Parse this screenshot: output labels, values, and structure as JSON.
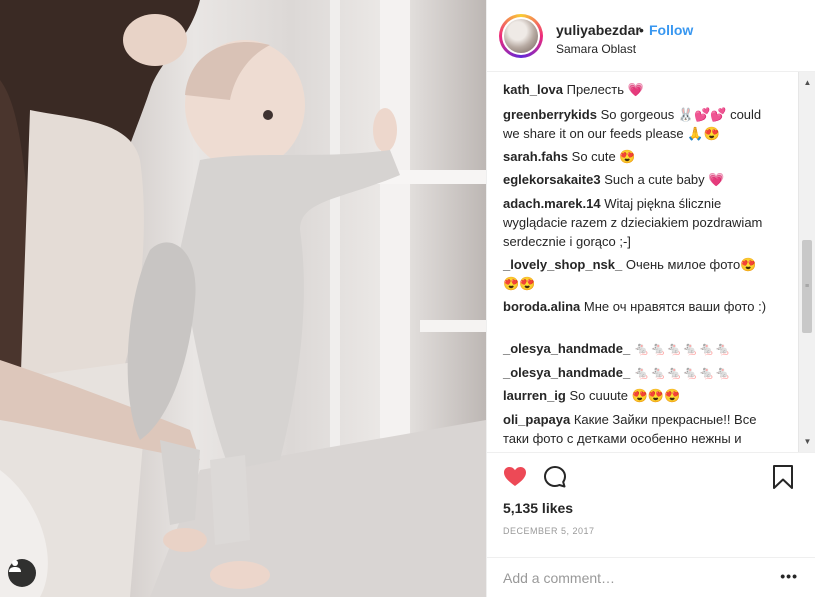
{
  "post": {
    "username": "yuliyabezdar",
    "separator": "•",
    "follow_label": "Follow",
    "location": "Samara Oblast"
  },
  "comments": [
    {
      "user": "kath_lova",
      "text": "Прелесть 💗"
    },
    {
      "user": "greenberrykids",
      "text": "So gorgeous 🐰💕💕 could we share it on our feeds please 🙏😍"
    },
    {
      "user": "sarah.fahs",
      "text": "So cute 😍"
    },
    {
      "user": "eglekorsakaite3",
      "text": "Such a cute baby 💗"
    },
    {
      "user": "adach.marek.14",
      "text": "Witaj piękna ślicznie wyglądacie razem z dzieciakiem pozdrawiam serdecznie i gorąco ;-]"
    },
    {
      "user": "_lovely_shop_nsk_",
      "text": "Очень милое фото😍😍😍"
    },
    {
      "user": "boroda.alina",
      "text": "Мне оч нравятся ваши фото :)"
    },
    {
      "user": "_olesya_handmade_",
      "text": "🐁🐁🐁🐁🐁🐁"
    },
    {
      "user": "_olesya_handmade_",
      "text": "🐁🐁🐁🐁🐁🐁"
    },
    {
      "user": "laurren_ig",
      "text": "So cuuute 😍😍😍"
    },
    {
      "user": "oli_papaya",
      "text": "Какие Зайки прекрасные!! Все таки фото с детками особенно нежны и"
    }
  ],
  "actions": {
    "like_icon": "heart-filled-icon",
    "comment_icon": "comment-bubble-icon",
    "save_icon": "bookmark-icon",
    "likes_text": "5,135 likes",
    "date_text": "DECEMBER 5, 2017"
  },
  "add_comment": {
    "placeholder": "Add a comment…",
    "more_label": "•••"
  },
  "colors": {
    "accent": "#3897f0",
    "like": "#ed4956",
    "border": "#efefef"
  }
}
